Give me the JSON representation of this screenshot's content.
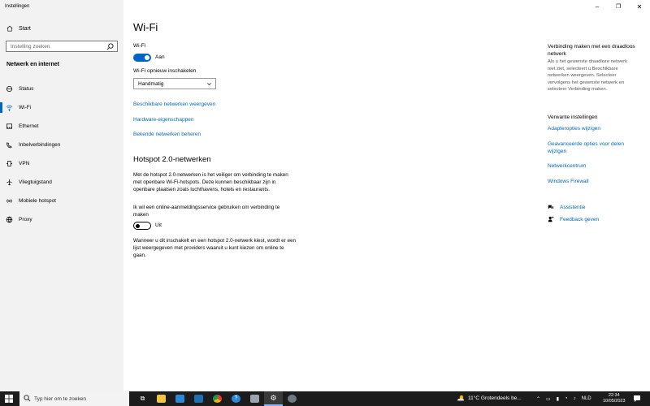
{
  "window": {
    "title": "Instellingen"
  },
  "sidebar": {
    "home_label": "Start",
    "search_placeholder": "Instelling zoeken",
    "section_title": "Netwerk en internet",
    "items": [
      {
        "label": "Status",
        "icon": "status-icon"
      },
      {
        "label": "Wi-Fi",
        "icon": "wifi-icon",
        "active": true
      },
      {
        "label": "Ethernet",
        "icon": "ethernet-icon"
      },
      {
        "label": "Inbelverbindingen",
        "icon": "dialup-icon"
      },
      {
        "label": "VPN",
        "icon": "vpn-icon"
      },
      {
        "label": "Vliegtuigstand",
        "icon": "airplane-icon"
      },
      {
        "label": "Mobiele hotspot",
        "icon": "hotspot-icon"
      },
      {
        "label": "Proxy",
        "icon": "proxy-icon"
      }
    ]
  },
  "main": {
    "title": "Wi-Fi",
    "wifi_label": "Wi-Fi",
    "wifi_state": "Aan",
    "reenable_label": "Wi-Fi opnieuw inschakelen",
    "reenable_value": "Handmatig",
    "links": [
      "Beschikbare netwerken weergeven",
      "Hardware-eigenschappen",
      "Bekende netwerken beheren"
    ],
    "hotspot_title": "Hotspot 2.0-netwerken",
    "hotspot_desc_1": "Met de hotspot 2.0-netwerken is het veiliger om verbinding te maken",
    "hotspot_desc_2": "met openbare Wi-Fi-hotspots. Deze kunnen beschikbaar zijn in",
    "hotspot_desc_3": "openbare plaatsen zoals luchthavens, hotels en restaurants.",
    "online_signup_1": "Ik wil een online-aanmeldingsservice gebruiken om verbinding te",
    "online_signup_2": "maken",
    "online_signup_state": "Uit",
    "note_1": "Wanneer u dit inschakelt en een hotspot 2.0-netwerk kiest, wordt er een",
    "note_2": "lijst weergegeven met providers waaruit u kunt kiezen om online te",
    "note_3": "gaan."
  },
  "right_pane": {
    "title_1": "Verbinding maken met een draadloos",
    "title_2": "netwerk",
    "desc_1": "Als u het gewenste draadloze netwerk",
    "desc_2": "niet ziet, selecteert u Beschikbare",
    "desc_3": "netwerken weergeven. Selecteer",
    "desc_4": "vervolgens het gewenste netwerk en",
    "desc_5": "selecteer Verbinding maken.",
    "related_title": "Verwante instellingen",
    "related_links": [
      "Adapteropties wijzigen",
      "Geavanceerde opties voor delen wijzigen",
      "Netwerkcentrum",
      "Windows Firewall"
    ],
    "help": "Assistentie",
    "feedback": "Feedback geven"
  },
  "taskbar": {
    "search_placeholder": "Typ hier om te zoeken",
    "weather": "11°C  Grotendeels be...",
    "lang": "NLD",
    "time": "22:34",
    "date": "10/05/2023"
  },
  "colors": {
    "accent": "#0067c0",
    "sidebar_bg": "#f2f2f2",
    "taskbar_bg": "#1c1c1c"
  }
}
